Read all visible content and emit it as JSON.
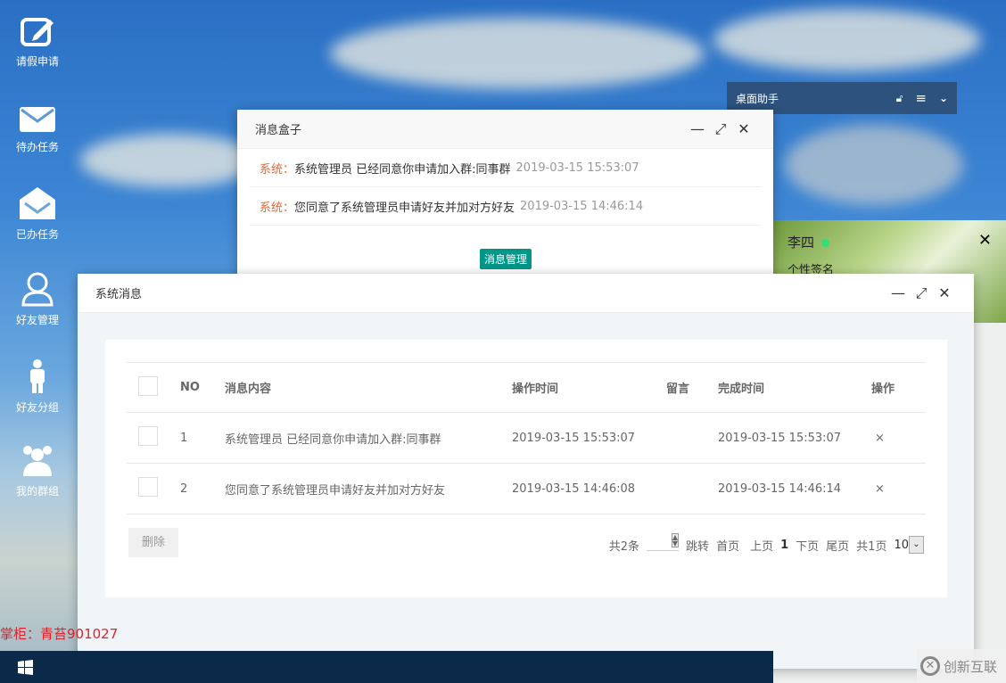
{
  "desktop_icons": [
    {
      "label": "请假申请",
      "icon": "edit-icon"
    },
    {
      "label": "待办任务",
      "icon": "mail-icon"
    },
    {
      "label": "已办任务",
      "icon": "mail-open-icon"
    },
    {
      "label": "好友管理",
      "icon": "user-icon"
    },
    {
      "label": "好友分组",
      "icon": "person-icon"
    },
    {
      "label": "我的群组",
      "icon": "group-icon"
    }
  ],
  "assistant": {
    "title": "桌面助手"
  },
  "msgbox": {
    "title": "消息盒子",
    "messages": [
      {
        "from": "系统：",
        "content": "系统管理员 已经同意你申请加入群:同事群",
        "time": "2019-03-15 15:53:07"
      },
      {
        "from": "系统：",
        "content": "您同意了系统管理员申请好友并加对方好友",
        "time": "2019-03-15 14:46:14"
      }
    ],
    "manage_button": "消息管理"
  },
  "friend_panel": {
    "name": "李四",
    "signature": "个性签名"
  },
  "sysmsg": {
    "title": "系统消息",
    "columns": [
      "NO",
      "消息内容",
      "操作时间",
      "留言",
      "完成时间",
      "操作"
    ],
    "rows": [
      {
        "no": "1",
        "content": "系统管理员 已经同意你申请加入群:同事群",
        "op_time": "2019-03-15 15:53:07",
        "note": "",
        "done_time": "2019-03-15 15:53:07",
        "action": "×"
      },
      {
        "no": "2",
        "content": "您同意了系统管理员申请好友并加对方好友",
        "op_time": "2019-03-15 14:46:08",
        "note": "",
        "done_time": "2019-03-15 14:46:14",
        "action": "×"
      }
    ],
    "delete_button": "删除",
    "pager": {
      "total": "共2条",
      "jump": "跳转",
      "first": "首页",
      "prev": "上页",
      "current": "1",
      "next": "下页",
      "last": "尾页",
      "pages": "共1页",
      "page_size": "10"
    }
  },
  "shopkeeper": "掌柜：青苔901027",
  "watermark": "创新互联",
  "colors": {
    "accent": "#009688",
    "system": "#e0693a",
    "taskbar": "#0b2a4a"
  }
}
